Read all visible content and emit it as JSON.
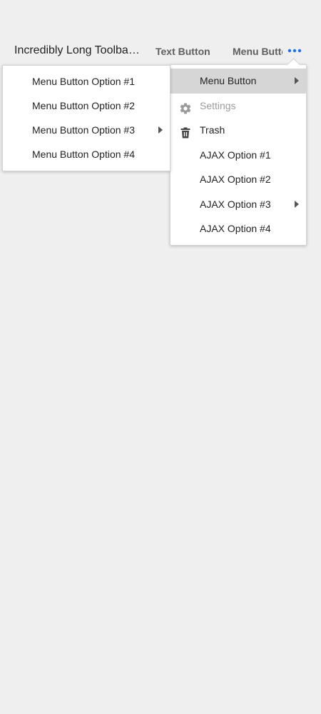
{
  "toolbar": {
    "title": "Incredibly Long Toolbar Title",
    "text_button_label": "Text Button",
    "menu_button_label": "Menu Button",
    "more_icon": "more-horizontal-icon",
    "accent_color": "#1a73e8"
  },
  "menu_button_menu": {
    "items": [
      {
        "label": "Menu Button Option #1"
      },
      {
        "label": "Menu Button Option #2"
      },
      {
        "label": "Menu Button Option #3",
        "has_submenu": true
      },
      {
        "label": "Menu Button Option #4"
      }
    ]
  },
  "overflow_menu": {
    "items": [
      {
        "label": "Menu Button",
        "has_submenu": true,
        "selected": true
      },
      {
        "label": "Settings",
        "icon": "gear-icon",
        "disabled": true
      },
      {
        "label": "Trash",
        "icon": "trash-icon"
      },
      {
        "label": "AJAX Option #1"
      },
      {
        "label": "AJAX Option #2"
      },
      {
        "label": "AJAX Option #3",
        "has_submenu": true
      },
      {
        "label": "AJAX Option #4"
      }
    ]
  },
  "colors": {
    "background": "#efefef",
    "selected_item": "#d6d6d6",
    "disabled_text": "#9b9b9b"
  }
}
